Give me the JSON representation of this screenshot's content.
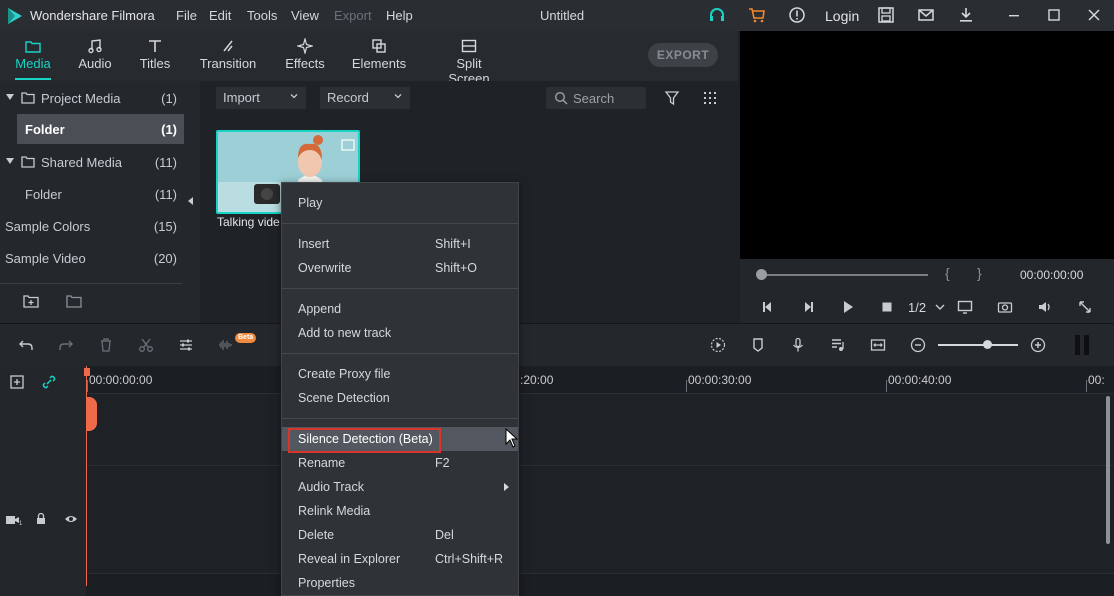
{
  "titlebar": {
    "app_name": "Wondershare Filmora",
    "menus": [
      "File",
      "Edit",
      "Tools",
      "View",
      "Export",
      "Help"
    ],
    "doc_title": "Untitled",
    "login_label": "Login"
  },
  "media_tabs": {
    "tabs": [
      "Media",
      "Audio",
      "Titles",
      "Transition",
      "Effects",
      "Elements",
      "Split Screen"
    ],
    "active": "Media",
    "export_label": "EXPORT"
  },
  "tree": {
    "items": [
      {
        "label": "Project Media",
        "count": "(1)"
      },
      {
        "label": "Folder",
        "count": "(1)"
      },
      {
        "label": "Shared Media",
        "count": "(11)"
      },
      {
        "label": "Folder",
        "count": "(11)"
      },
      {
        "label": "Sample Colors",
        "count": "(15)"
      },
      {
        "label": "Sample Video",
        "count": "(20)"
      }
    ]
  },
  "library": {
    "import_label": "Import",
    "record_label": "Record",
    "search_placeholder": "Search",
    "thumb_label": "Talking vide"
  },
  "preview": {
    "timecode": "00:00:00:00",
    "ratio": "1/2",
    "left_brace": "{",
    "right_brace": "}"
  },
  "timeline_toolbar": {
    "beta_badge": "Beta"
  },
  "ruler": {
    "ticks": [
      "00:00:00:00",
      ":20:00",
      "00:00:30:00",
      "00:00:40:00",
      "00:"
    ]
  },
  "context_menu": {
    "items": [
      {
        "label": "Play",
        "shortcut": ""
      },
      {
        "label": "Insert",
        "shortcut": "Shift+I"
      },
      {
        "label": "Overwrite",
        "shortcut": "Shift+O"
      },
      {
        "label": "Append",
        "shortcut": ""
      },
      {
        "label": "Add to new track",
        "shortcut": ""
      },
      {
        "label": "Create Proxy file",
        "shortcut": ""
      },
      {
        "label": "Scene Detection",
        "shortcut": ""
      },
      {
        "label": "Silence Detection (Beta)",
        "shortcut": ""
      },
      {
        "label": "Rename",
        "shortcut": "F2"
      },
      {
        "label": "Audio Track",
        "shortcut": ""
      },
      {
        "label": "Relink Media",
        "shortcut": ""
      },
      {
        "label": "Delete",
        "shortcut": "Del"
      },
      {
        "label": "Reveal in Explorer",
        "shortcut": "Ctrl+Shift+R"
      },
      {
        "label": "Properties",
        "shortcut": ""
      }
    ]
  },
  "colors": {
    "accent": "#19d3c5",
    "playhead": "#f06a4a",
    "highlight_box": "#d9362b"
  },
  "icons": [
    "filmora-logo-icon",
    "headset-icon",
    "cart-icon",
    "info-icon",
    "save-icon",
    "mail-icon",
    "download-icon",
    "minimize-icon",
    "maximize-icon",
    "close-icon"
  ]
}
